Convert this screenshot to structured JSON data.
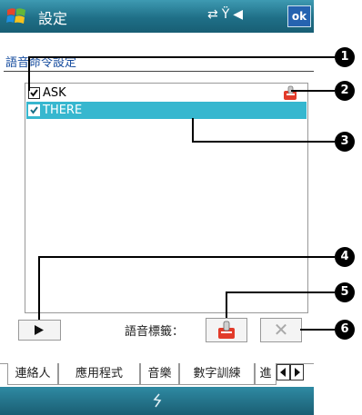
{
  "titlebar": {
    "title": "設定",
    "ok_label": "ok",
    "status_icons": "connectivity-icon signal-icon volume-icon"
  },
  "subheader": "語音命令設定",
  "list": {
    "items": [
      {
        "label": "ASK",
        "checked": true,
        "has_voice_tag": true,
        "selected": false
      },
      {
        "label": "THERE",
        "checked": true,
        "has_voice_tag": false,
        "selected": true
      }
    ]
  },
  "controls": {
    "play_icon": "play-icon",
    "voice_tag_label": "語音標籤：",
    "record_icon": "record-voice-tag-icon",
    "delete_symbol": "✕"
  },
  "tabs": [
    {
      "label": "連絡人"
    },
    {
      "label": "應用程式"
    },
    {
      "label": "音樂"
    },
    {
      "label": "數字訓練"
    },
    {
      "label": "進"
    }
  ],
  "callouts": [
    "1",
    "2",
    "3",
    "4",
    "5",
    "6"
  ],
  "colors": {
    "titlebar": "#1f6f87",
    "selection": "#36b7cf",
    "accent_text": "#1a4fa0"
  }
}
